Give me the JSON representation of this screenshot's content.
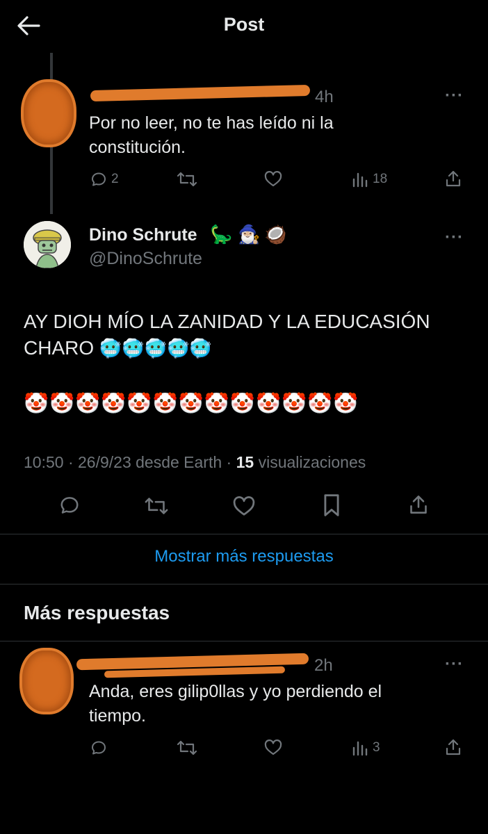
{
  "header": {
    "title": "Post"
  },
  "reply_top": {
    "time": "4h",
    "text_line1": "Por no leer, no te has leído ni la",
    "text_line2": "constitución.",
    "reply_count": "2",
    "view_count": "18"
  },
  "main_post": {
    "display_name": "Dino Schrute",
    "name_emojis": [
      "🦕",
      "🧙🏼‍♂️",
      "🥥"
    ],
    "handle": "@DinoSchrute",
    "text_line1": "AY DIOH MÍO LA ZANIDAD Y LA EDUCASIÓN",
    "text_line2_word": "CHARO",
    "text_line2_emojis": "🥶🥶🥶🥶🥶",
    "emoji_line": "🤡🤡🤡🤡🤡🤡🤡🤡🤡🤡🤡🤡🤡",
    "timestamp_prefix": "10:50 · 26/9/23 desde Earth · ",
    "view_count": "15",
    "view_label": " visualizaciones"
  },
  "show_more_label": "Mostrar más respuestas",
  "more_replies_title": "Más respuestas",
  "reply_bottom": {
    "time": "2h",
    "text_line1": "Anda, eres gilip0llas y yo perdiendo el",
    "text_line2": "tiempo.",
    "view_count": "3"
  },
  "colors": {
    "accent": "#1d9bf0",
    "muted": "#71767b",
    "redaction": "#e07b2c",
    "background": "#000000"
  },
  "icons": [
    "back-arrow-icon",
    "reply-icon",
    "retweet-icon",
    "like-icon",
    "views-icon",
    "share-icon",
    "bookmark-icon",
    "more-icon"
  ]
}
